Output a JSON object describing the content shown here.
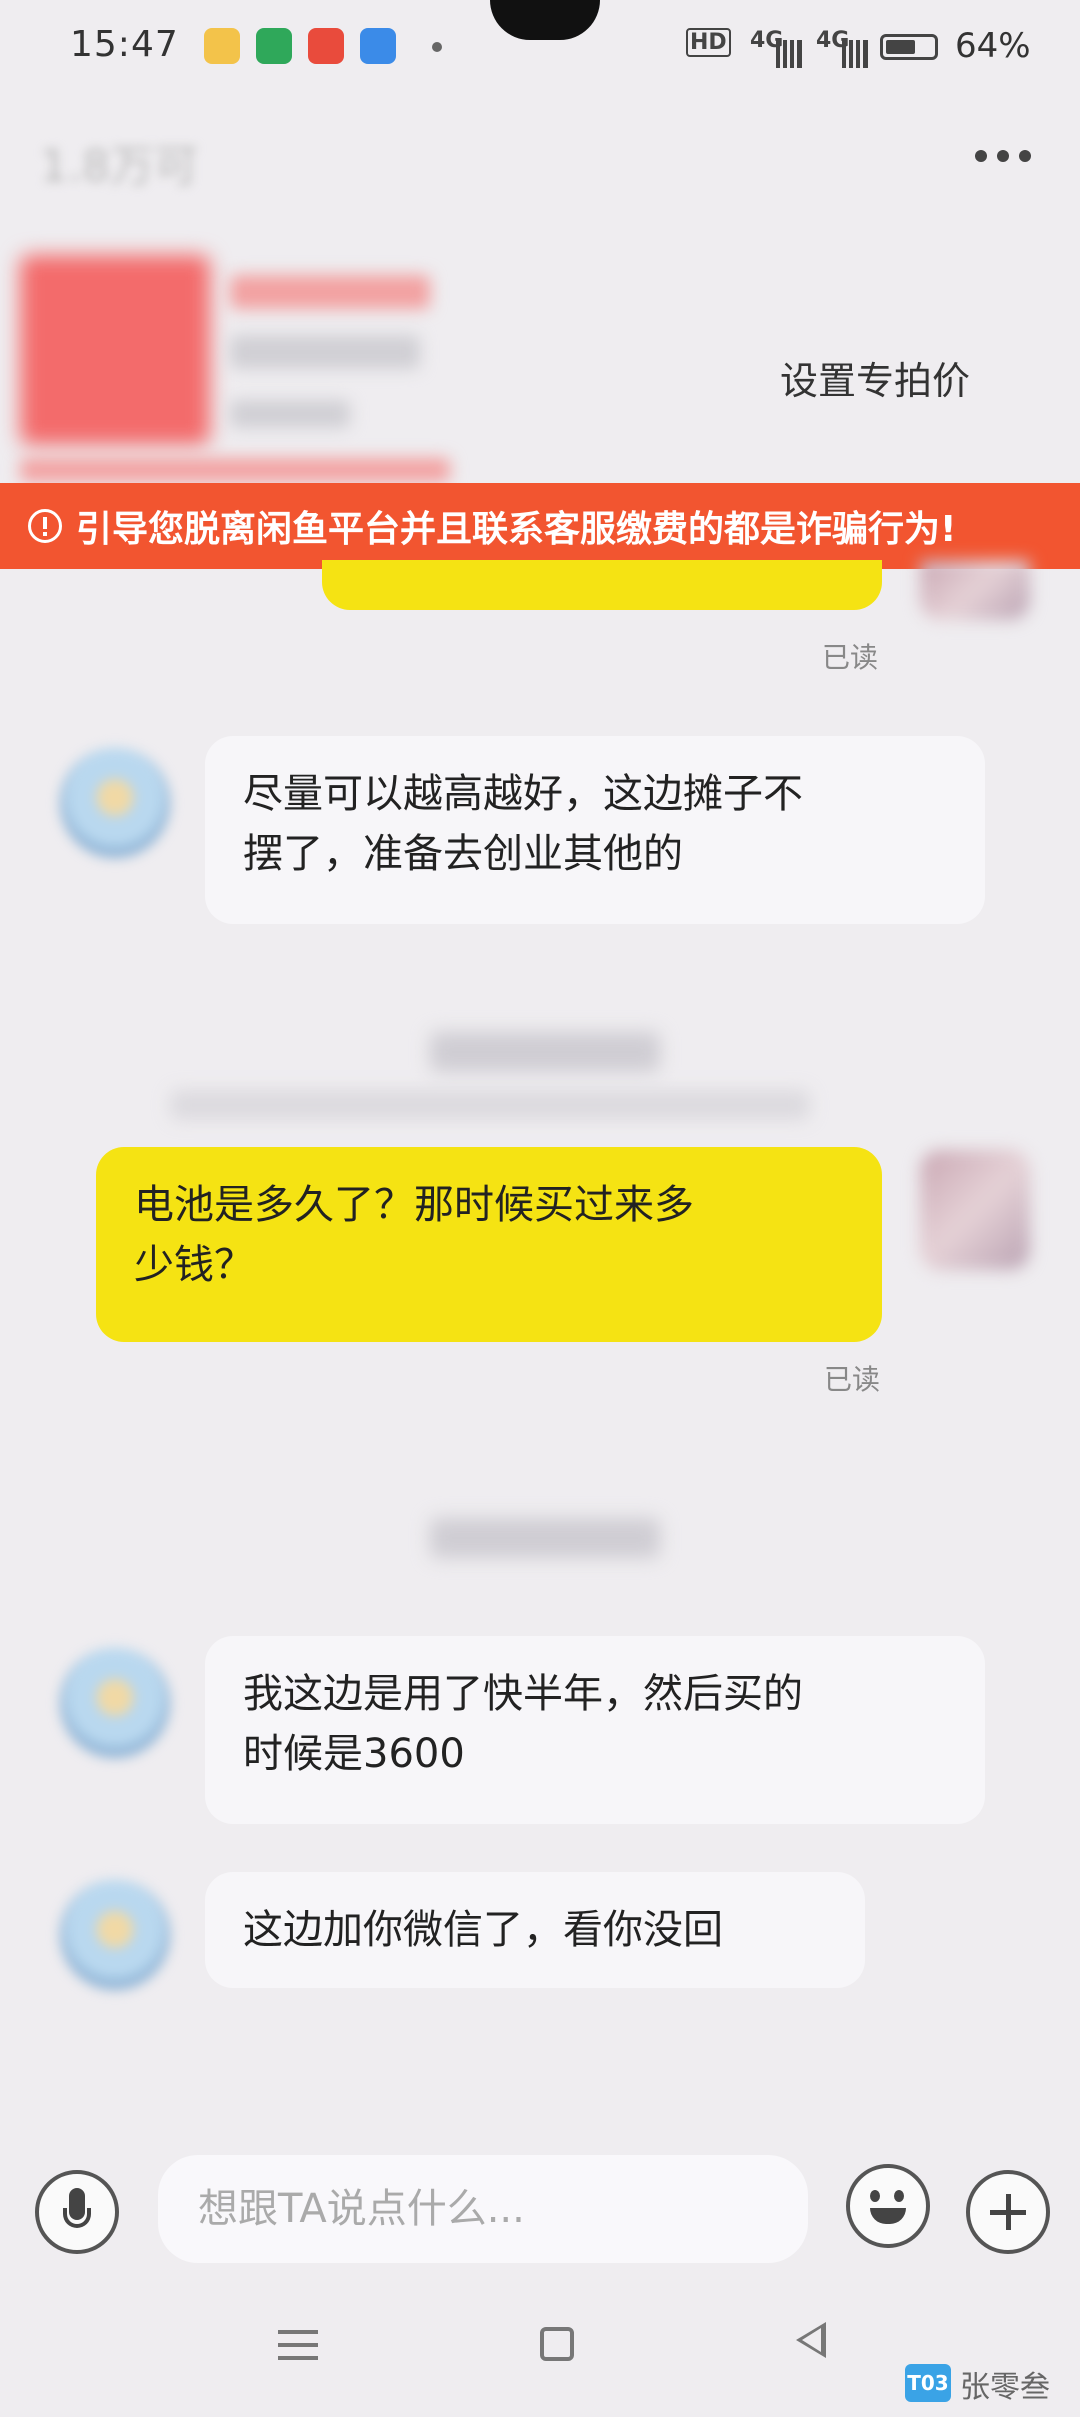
{
  "status_bar": {
    "time": "15:47",
    "network": [
      "HD",
      "4G",
      "4G"
    ],
    "battery_percent": "64%",
    "battery_level": 0.64
  },
  "header": {
    "title": "1.8万可",
    "set_price_button": "设置专拍价"
  },
  "warning_banner": {
    "text": "引导您脱离闲鱼平台并且联系客服缴费的都是诈骗行为!"
  },
  "messages": {
    "m0": {
      "read": "已读"
    },
    "m1": {
      "line1": "尽量可以越高越好，这边摊子不",
      "line2": "摆了，准备去创业其他的"
    },
    "m2": {
      "line1": "电池是多久了？那时候买过来多",
      "line2": "少钱？",
      "read": "已读"
    },
    "m3": {
      "line1": "我这边是用了快半年，然后买的",
      "line2": "时候是3600"
    },
    "m4": {
      "text": "这边加你微信了，看你没回"
    }
  },
  "input_bar": {
    "placeholder": "想跟TA说点什么..."
  },
  "watermark": {
    "logo": "T03",
    "text": "张零叁"
  }
}
